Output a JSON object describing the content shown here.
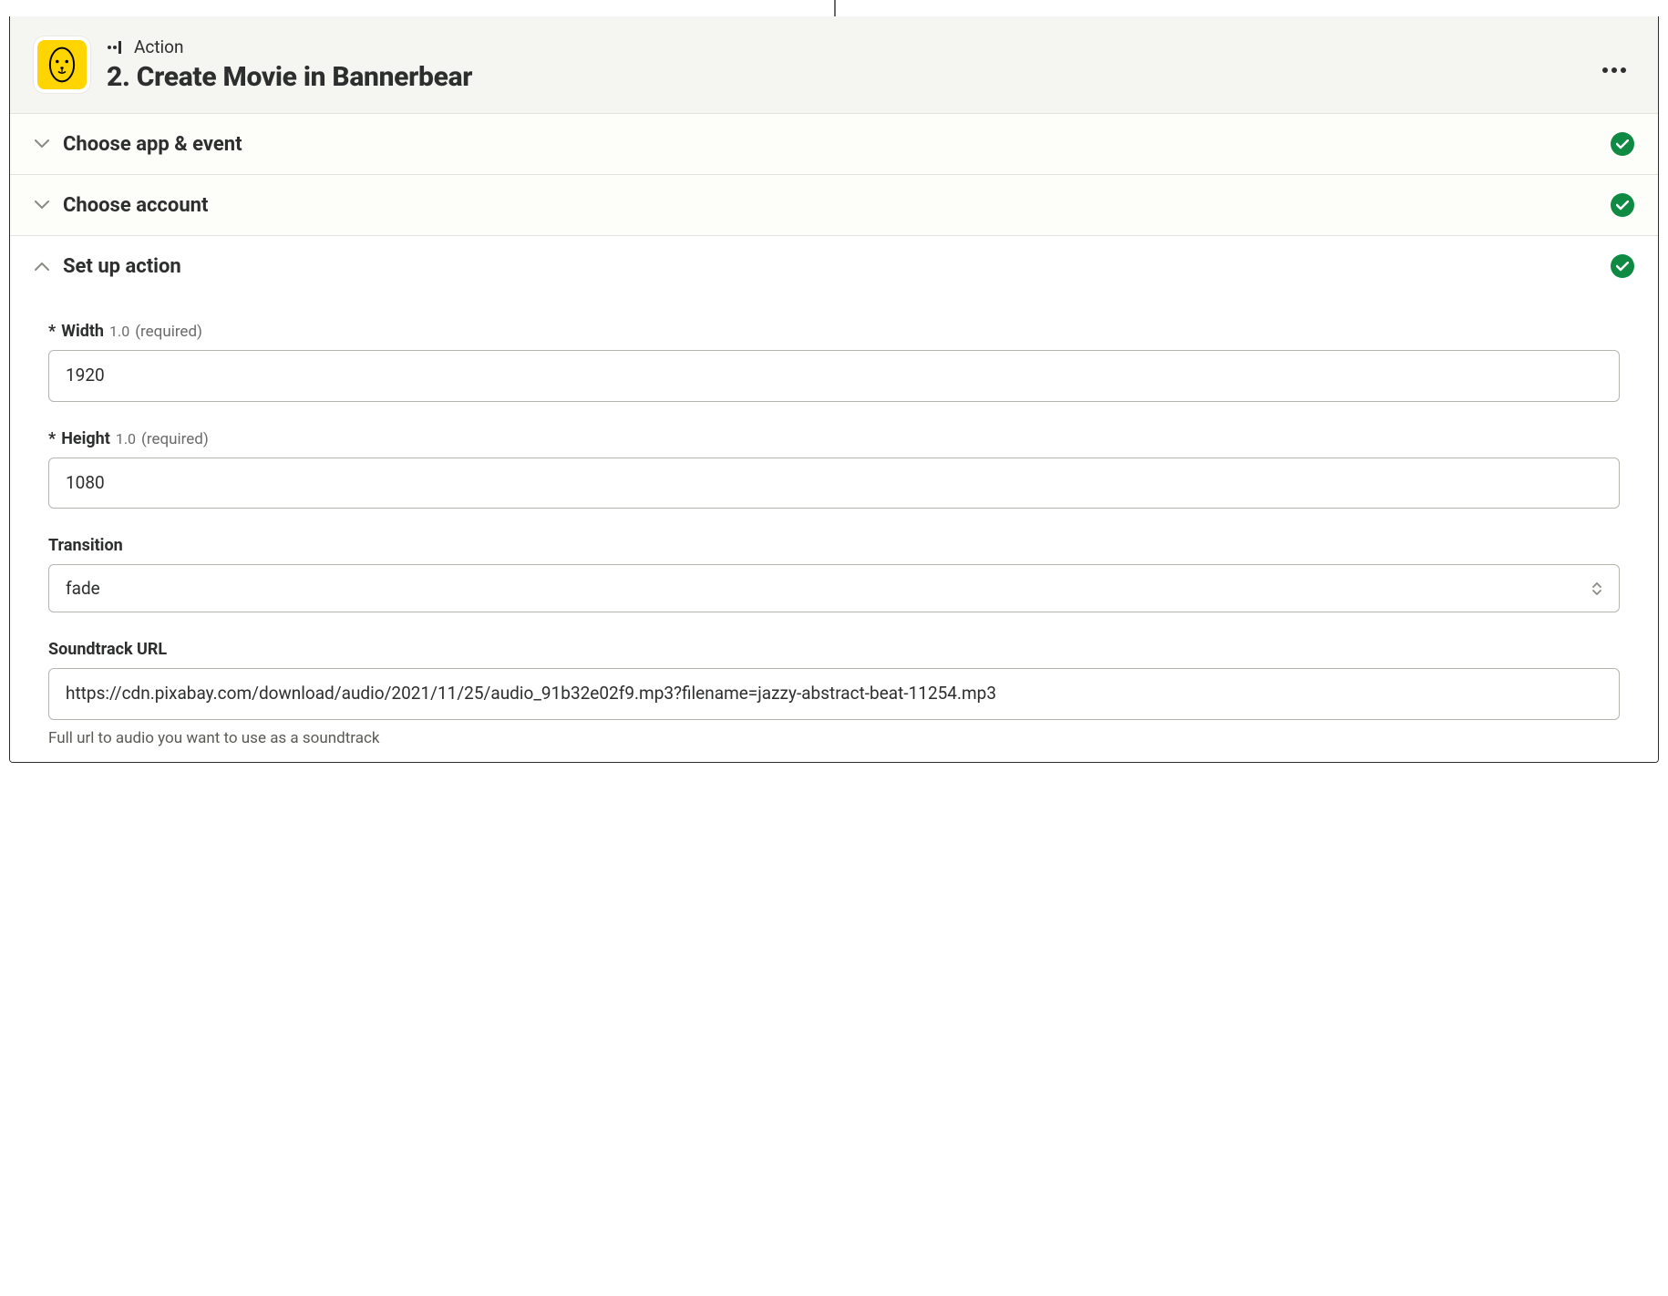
{
  "header": {
    "action_label": "Action",
    "title": "2. Create Movie in Bannerbear"
  },
  "sections": {
    "choose_app": {
      "title": "Choose app & event"
    },
    "choose_account": {
      "title": "Choose account"
    },
    "setup_action": {
      "title": "Set up action"
    }
  },
  "fields": {
    "width": {
      "asterisk": "*",
      "label": "Width",
      "version": "1.0",
      "required": "(required)",
      "value": "1920"
    },
    "height": {
      "asterisk": "*",
      "label": "Height",
      "version": "1.0",
      "required": "(required)",
      "value": "1080"
    },
    "transition": {
      "label": "Transition",
      "value": "fade"
    },
    "soundtrack": {
      "label": "Soundtrack URL",
      "value": "https://cdn.pixabay.com/download/audio/2021/11/25/audio_91b32e02f9.mp3?filename=jazzy-abstract-beat-11254.mp3",
      "help": "Full url to audio you want to use as a soundtrack"
    }
  }
}
